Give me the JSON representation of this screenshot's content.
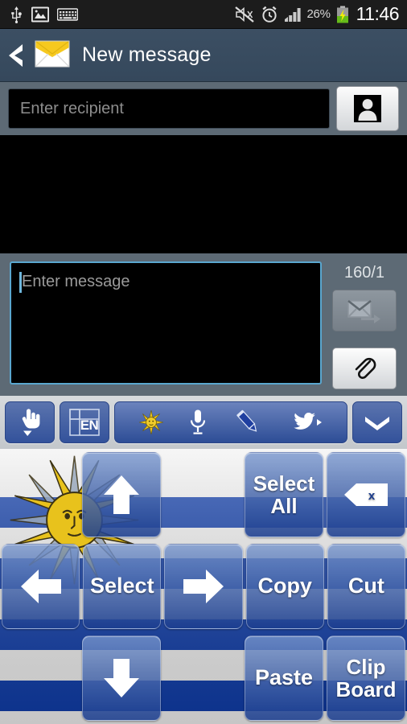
{
  "status_bar": {
    "icons": [
      "usb-icon",
      "image-icon",
      "keyboard-icon"
    ],
    "right_icons": [
      "mute-vibrate-off-icon",
      "alarm-icon",
      "signal-icon"
    ],
    "battery_percent": "26%",
    "battery_icon": "battery-charging-icon",
    "clock": "11:46"
  },
  "title_bar": {
    "back_icon": "back-chevron-icon",
    "app_icon": "envelope-icon",
    "title": "New message"
  },
  "recipient": {
    "placeholder": "Enter recipient",
    "value": "",
    "contact_button_icon": "contact-person-icon"
  },
  "compose": {
    "message_placeholder": "Enter message",
    "message_value": "",
    "counter": "160/1",
    "send_icon": "send-message-icon",
    "attach_icon": "paperclip-icon"
  },
  "keyboard_toolbar": {
    "handwriting_icon": "hand-down-icon",
    "language_key": "EN",
    "language_icon": "layout-icon",
    "group_icons": [
      "sun-icon",
      "microphone-icon",
      "pencil-icon",
      "twitter-bird-icon"
    ],
    "collapse_icon": "chevron-down-icon"
  },
  "keyboard": {
    "theme": "uruguay-flag",
    "rows": [
      [
        {
          "name": "blank",
          "label": "",
          "type": "blank"
        },
        {
          "name": "arrow-up-key",
          "label": "",
          "icon": "arrow-up-icon"
        },
        {
          "name": "blank",
          "label": "",
          "type": "blank"
        },
        {
          "name": "select-all-key",
          "label": "Select\nAll"
        },
        {
          "name": "backspace-key",
          "label": "",
          "icon": "backspace-icon"
        }
      ],
      [
        {
          "name": "arrow-left-key",
          "label": "",
          "icon": "arrow-left-icon"
        },
        {
          "name": "select-key",
          "label": "Select"
        },
        {
          "name": "arrow-right-key",
          "label": "",
          "icon": "arrow-right-icon"
        },
        {
          "name": "copy-key",
          "label": "Copy"
        },
        {
          "name": "cut-key",
          "label": "Cut"
        }
      ],
      [
        {
          "name": "blank",
          "label": "",
          "type": "blank"
        },
        {
          "name": "arrow-down-key",
          "label": "",
          "icon": "arrow-down-icon"
        },
        {
          "name": "blank",
          "label": "",
          "type": "blank"
        },
        {
          "name": "paste-key",
          "label": "Paste"
        },
        {
          "name": "clipboard-key",
          "label": "Clip\nBoard"
        }
      ]
    ]
  },
  "colors": {
    "titlebar": "#3c4f63",
    "chrome": "#5d6a75",
    "field_focus": "#5aa7cf",
    "key_blue": "#2d4d96",
    "flag_blue": "#0e3caa",
    "sun_yellow": "#e8c21c"
  }
}
